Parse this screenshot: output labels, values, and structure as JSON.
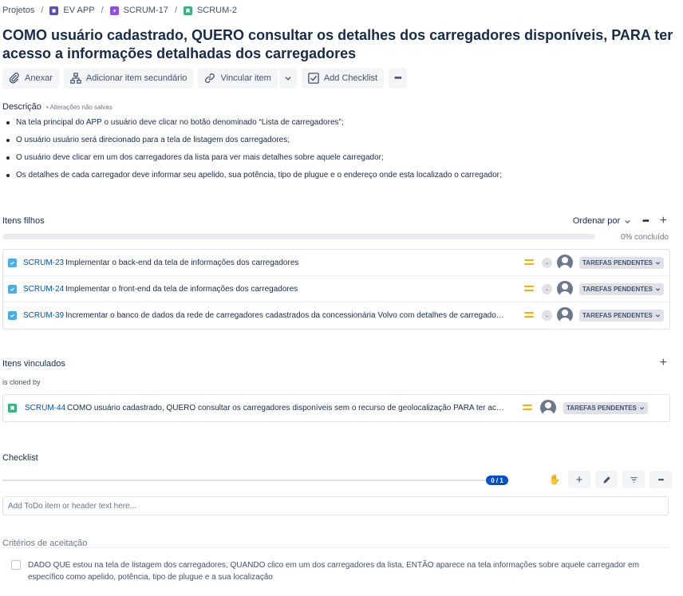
{
  "breadcrumb": {
    "items": [
      {
        "label": "Projetos",
        "icon": ""
      },
      {
        "label": "EV APP",
        "icon": "project-icon"
      },
      {
        "label": "SCRUM-17",
        "icon": "epic-icon"
      },
      {
        "label": "SCRUM-2",
        "icon": "story-icon"
      }
    ],
    "separator": "/"
  },
  "issue": {
    "title": "COMO usuário cadastrado, QUERO consultar os detalhes dos carregadores disponíveis, PARA ter acesso a informações detalhadas dos carregadores"
  },
  "toolbar": {
    "attach": "Anexar",
    "add_child": "Adicionar item secundário",
    "link": "Vincular item",
    "checklist": "Add Checklist",
    "more": "•••"
  },
  "description": {
    "label": "Descrição",
    "unsaved": "• Alterações não salvas",
    "items": [
      "Na tela principal do APP o usuário deve clicar no botão denominado “Lista de carregadores”;",
      "O usuário usuário será direcionado para a tela de listagem dos carregadores;",
      "O usuário deve clicar em um dos carregadores da lista para ver mais detalhes sobre aquele carregador;",
      "Os detalhes de cada carregador deve informar seu apelido, sua potência, tipo de plugue e o endereço onde esta localizado o carregador;"
    ]
  },
  "child_items": {
    "title": "Itens filhos",
    "sort_label": "Ordenar por",
    "more": "•••",
    "add": "+",
    "progress_percent": 0,
    "progress_text": "0% concluído",
    "rows": [
      {
        "key": "SCRUM-23",
        "summary": "Implementar o back-end da tela de informações dos carregadores",
        "estimate": "-",
        "status": "TAREFAS PENDENTES"
      },
      {
        "key": "SCRUM-24",
        "summary": "Implementar o front-end da tela de informações dos carregadores",
        "estimate": "-",
        "status": "TAREFAS PENDENTES"
      },
      {
        "key": "SCRUM-39",
        "summary": "Incrementar o banco de dados da rede de carregadores cadastrados da concessionária Volvo com detalhes de carregadores",
        "estimate": "-",
        "status": "TAREFAS PENDENTES"
      }
    ]
  },
  "linked_items": {
    "title": "Itens vinculados",
    "add": "+",
    "relation": "is cloned by",
    "rows": [
      {
        "key": "SCRUM-44",
        "summary": "COMO usuário cadastrado, QUERO consultar os carregadores disponíveis sem o recurso de geolocalização PARA ter acesso",
        "status": "TAREFAS PENDENTES"
      }
    ]
  },
  "checklist": {
    "title": "Checklist",
    "progress": "0 / 1",
    "input_placeholder": "Add ToDo item or header text here...",
    "tools": {
      "wave": "✋",
      "add": "+",
      "edit": "✎",
      "filter": "⚲",
      "more": "•••"
    }
  },
  "criteria": {
    "title": "Critérios de aceitação",
    "items": [
      "DADO QUE estou na tela de listagem dos carregadores, QUANDO clico em um dos carregadores da lista, ENTÃO aparece na tela informações sobre aquele carregador em específico como apelido, potência, tipo de plugue e a sua localização"
    ]
  },
  "colors": {
    "link": "#0052cc",
    "priority_medium": "#ffab00",
    "story": "#36b37e",
    "task": "#4bade8",
    "epic": "#904ee2"
  }
}
